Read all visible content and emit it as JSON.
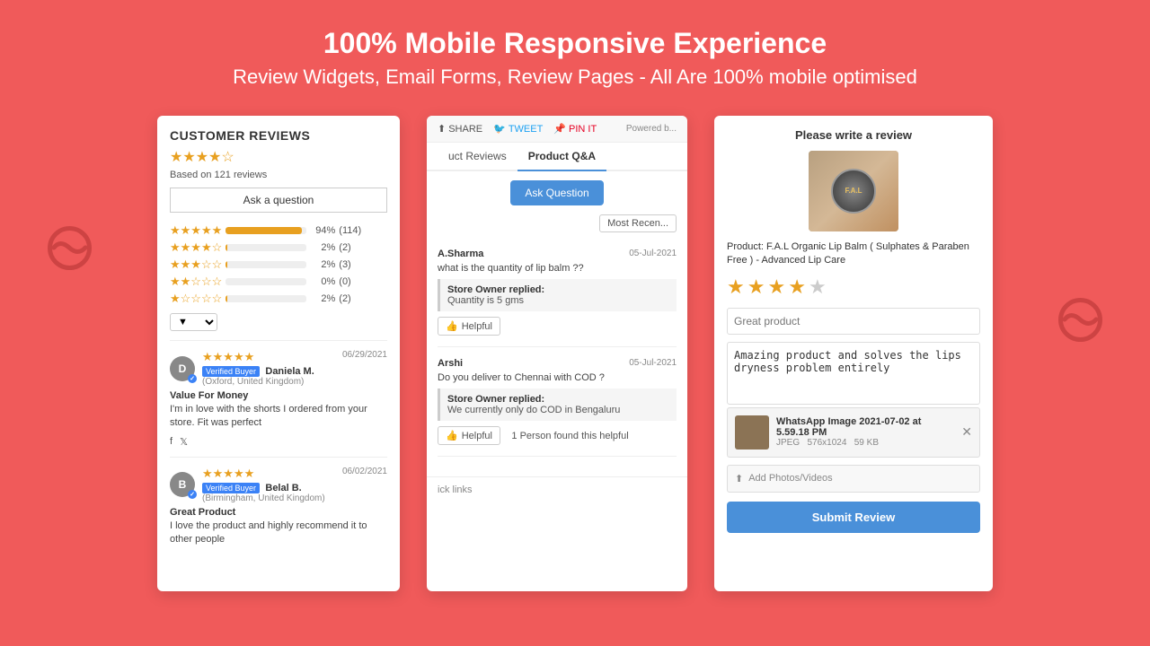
{
  "header": {
    "title": "100% Mobile Responsive Experience",
    "subtitle": "Review Widgets, Email Forms, Review Pages - All Are 100% mobile optimised"
  },
  "panel1": {
    "title": "CUSTOMER REVIEWS",
    "overall_stars": "★★★★☆",
    "based_on": "Based on 121 reviews",
    "ask_btn": "Ask a question",
    "bars": [
      {
        "stars": "★★★★★",
        "pct": "94%",
        "fill": 94,
        "count": "(114)"
      },
      {
        "stars": "★★★★☆",
        "pct": "2%",
        "fill": 2,
        "count": "(2)"
      },
      {
        "stars": "★★★☆☆",
        "pct": "2%",
        "fill": 2,
        "count": "(3)"
      },
      {
        "stars": "★★☆☆☆",
        "pct": "0%",
        "fill": 0,
        "count": "(0)"
      },
      {
        "stars": "★☆☆☆☆",
        "pct": "2%",
        "fill": 2,
        "count": "(2)"
      }
    ],
    "reviews": [
      {
        "avatar": "D",
        "verified": "Verified Buyer",
        "name": "Daniela M.",
        "location": "(Oxford, United Kingdom)",
        "date": "06/29/2021",
        "stars": "★★★★★",
        "title": "Value For Money",
        "text": "I'm in love with the shorts I ordered from your store. Fit was perfect"
      },
      {
        "avatar": "B",
        "verified": "Verified Buyer",
        "name": "Belal B.",
        "location": "(Birmingham, United Kingdom)",
        "date": "06/02/2021",
        "stars": "★★★★★",
        "title": "Great Product",
        "text": "I love the product and highly recommend it to other people"
      }
    ]
  },
  "panel2": {
    "share_label": "SHARE",
    "tweet_label": "TWEET",
    "pin_label": "PIN IT",
    "powered_label": "Powered b...",
    "tab1": "uct Reviews",
    "tab2": "Product Q&A",
    "ask_question_btn": "Ask Question",
    "most_recent_btn": "Most Recen...",
    "questions": [
      {
        "author": "A.Sharma",
        "date": "05-Jul-2021",
        "text": "what is the quantity of lip balm ??",
        "reply_label": "Store Owner replied:",
        "reply_text": "Quantity is 5 gms",
        "helpful_btn": "Helpful",
        "helpful_count": ""
      },
      {
        "author": "Arshi",
        "date": "05-Jul-2021",
        "text": "Do you deliver to Chennai with COD ?",
        "reply_label": "Store Owner replied:",
        "reply_text": "We currently only do COD in Bengaluru",
        "helpful_btn": "Helpful",
        "helpful_count": "1 Person found this helpful"
      }
    ],
    "footer": "ick links"
  },
  "panel3": {
    "title": "Please write a review",
    "product_label": "F.A.L",
    "product_desc": "Product: F.A.L Organic Lip Balm ( Sulphates & Paraben Free ) - Advanced Lip Care",
    "stars_filled": 4,
    "stars_total": 5,
    "review_title_placeholder": "Great product",
    "review_text": "Amazing product and solves the lips dryness problem entirely",
    "attachment_name": "WhatsApp Image 2021-07-02 at 5.59.18 PM",
    "attachment_type": "JPEG",
    "attachment_dims": "576x1024",
    "attachment_size": "59 KB",
    "add_photos_label": "Add Photos/Videos",
    "submit_btn": "Submit Review"
  }
}
